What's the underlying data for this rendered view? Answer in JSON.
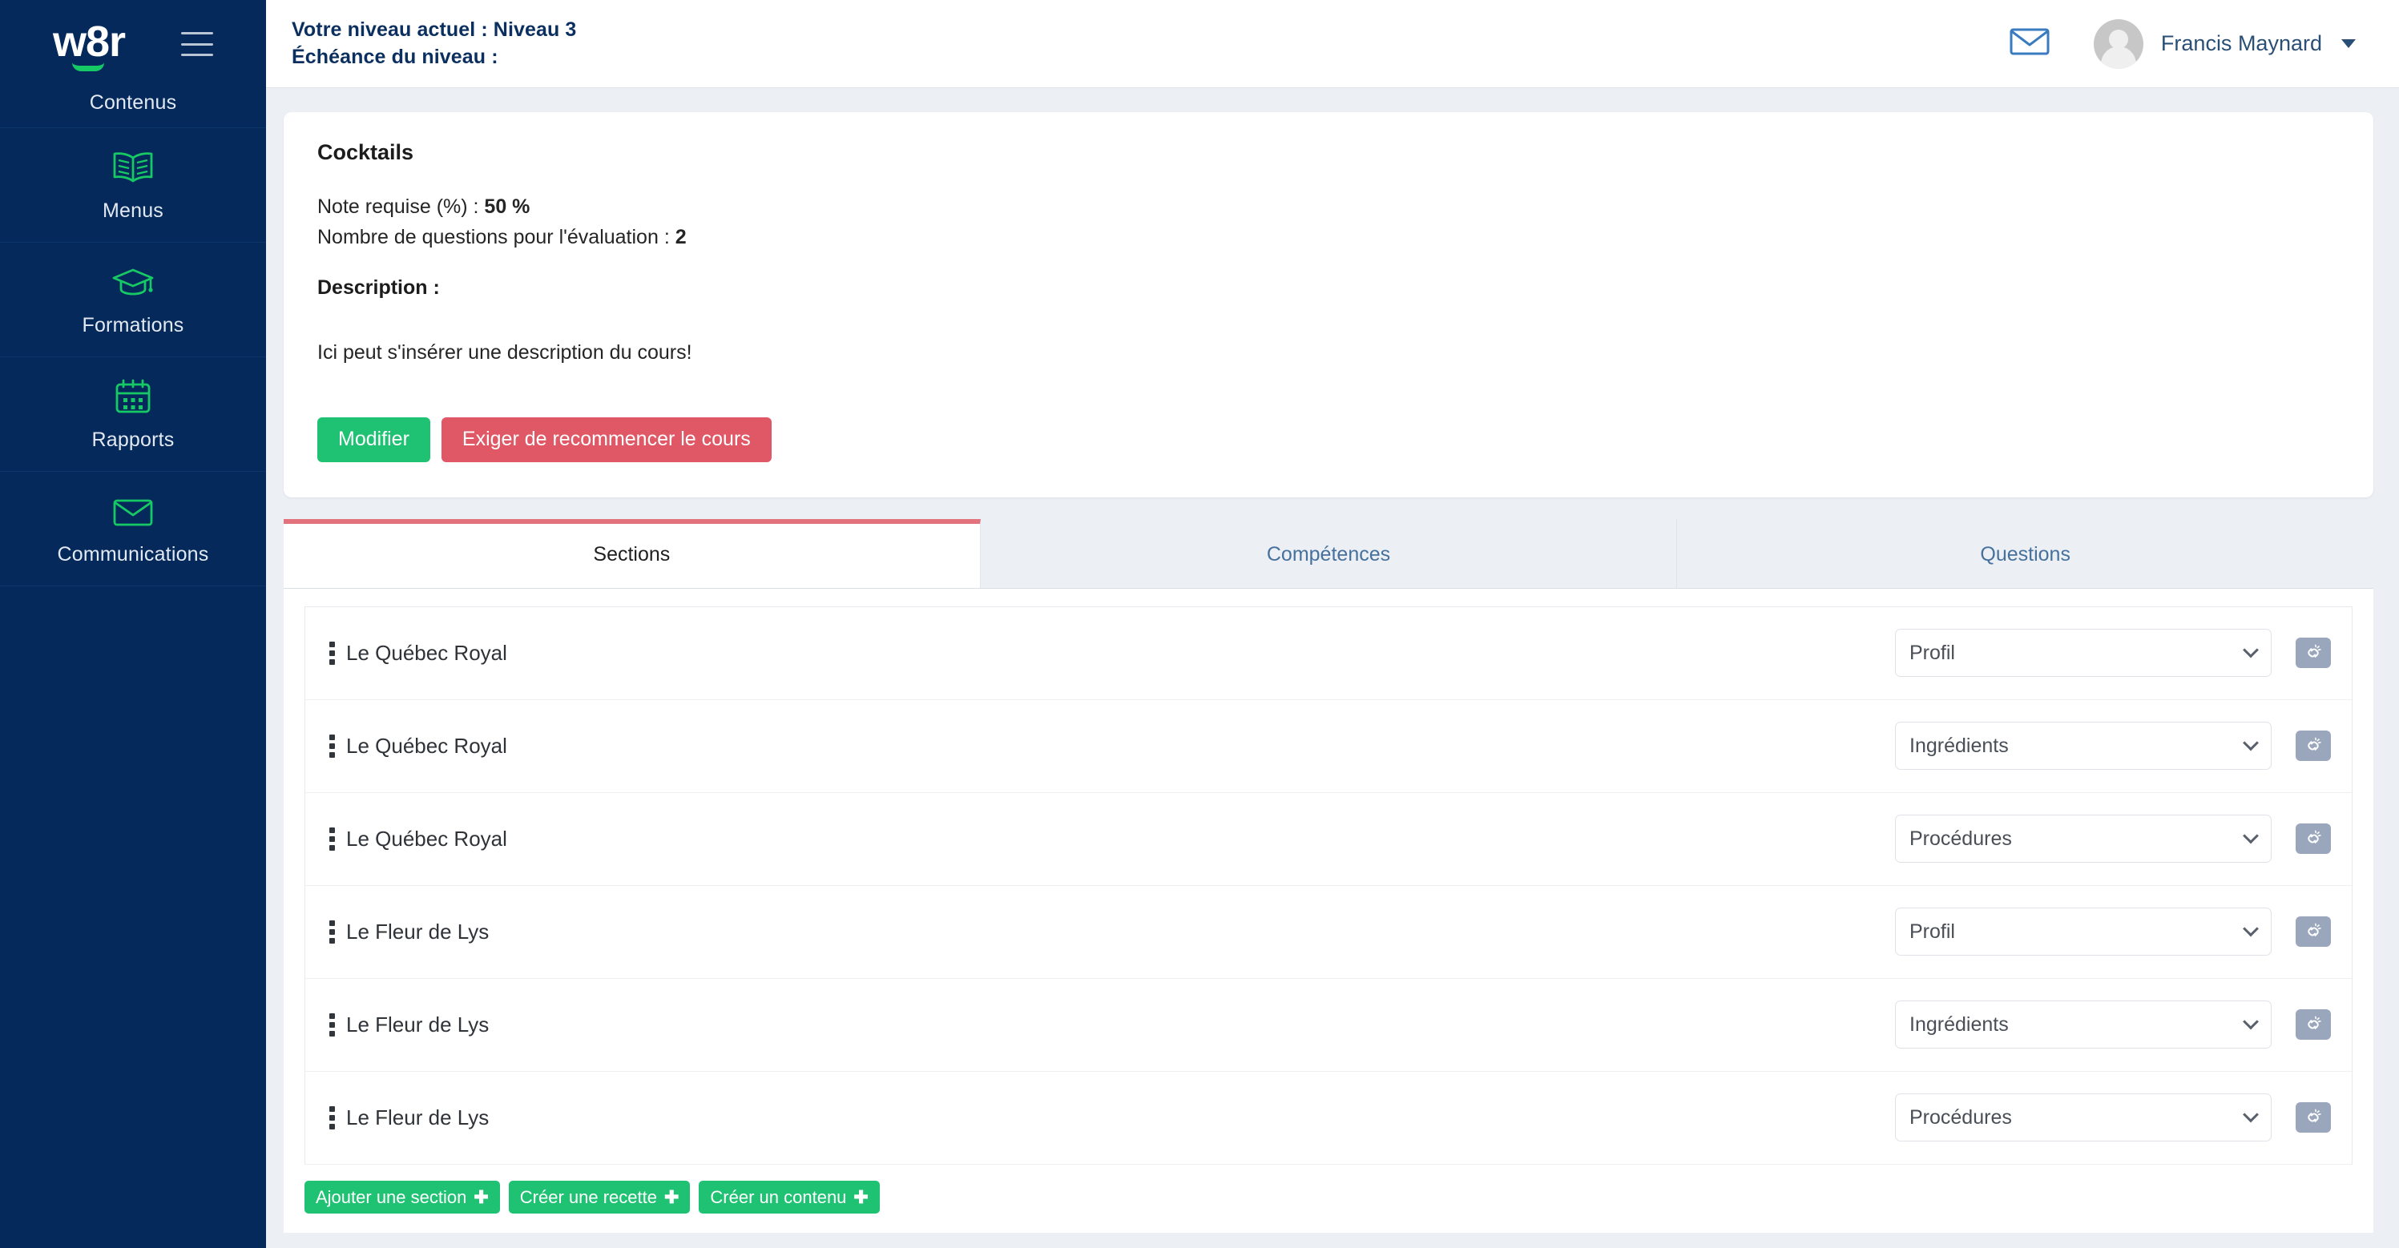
{
  "sidebar": {
    "logo_text": "w8r",
    "items": [
      {
        "label": "Contenus",
        "icon": "book-partial-icon",
        "clipped": true
      },
      {
        "label": "Menus",
        "icon": "open-book-icon",
        "clipped": false
      },
      {
        "label": "Formations",
        "icon": "graduation-cap-icon",
        "clipped": false
      },
      {
        "label": "Rapports",
        "icon": "calendar-icon",
        "clipped": false
      },
      {
        "label": "Communications",
        "icon": "envelope-icon",
        "clipped": false
      }
    ]
  },
  "topbar": {
    "level_line": "Votre niveau actuel : Niveau 3",
    "deadline_line": "Échéance du niveau :",
    "mail_icon": "envelope-icon",
    "user_name": "Francis Maynard",
    "avatar_icon": "user-avatar-icon",
    "caret_icon": "chevron-down-icon"
  },
  "course_card": {
    "title": "Cocktails",
    "required_grade_label": "Note requise (%) : ",
    "required_grade_value": "50 %",
    "question_count_label": "Nombre de questions pour l'évaluation : ",
    "question_count_value": "2",
    "description_label": "Description :",
    "description_text": "Ici peut s'insérer une description du cours!",
    "edit_button": "Modifier",
    "restart_button": "Exiger de recommencer le cours"
  },
  "tabs": [
    {
      "label": "Sections",
      "active": true
    },
    {
      "label": "Compétences",
      "active": false
    },
    {
      "label": "Questions",
      "active": false
    }
  ],
  "sections": [
    {
      "title": "Le Québec Royal",
      "type": "Profil",
      "unlink_icon": "unlink-icon"
    },
    {
      "title": "Le Québec Royal",
      "type": "Ingrédients",
      "unlink_icon": "unlink-icon"
    },
    {
      "title": "Le Québec Royal",
      "type": "Procédures",
      "unlink_icon": "unlink-icon"
    },
    {
      "title": "Le Fleur de Lys",
      "type": "Profil",
      "unlink_icon": "unlink-icon"
    },
    {
      "title": "Le Fleur de Lys",
      "type": "Ingrédients",
      "unlink_icon": "unlink-icon"
    },
    {
      "title": "Le Fleur de Lys",
      "type": "Procédures",
      "unlink_icon": "unlink-icon"
    }
  ],
  "section_type_options": [
    "Profil",
    "Ingrédients",
    "Procédures"
  ],
  "bottom_actions": [
    {
      "label": "Ajouter une section",
      "plus": "✚"
    },
    {
      "label": "Créer une recette",
      "plus": "✚"
    },
    {
      "label": "Créer un contenu",
      "plus": "✚"
    }
  ],
  "colors": {
    "sidebar_bg": "#04295a",
    "accent_green": "#1fc272",
    "danger_red": "#e05765",
    "tab_active_border": "#e2737d",
    "page_bg": "#eceff4",
    "link_blue": "#46719c"
  }
}
